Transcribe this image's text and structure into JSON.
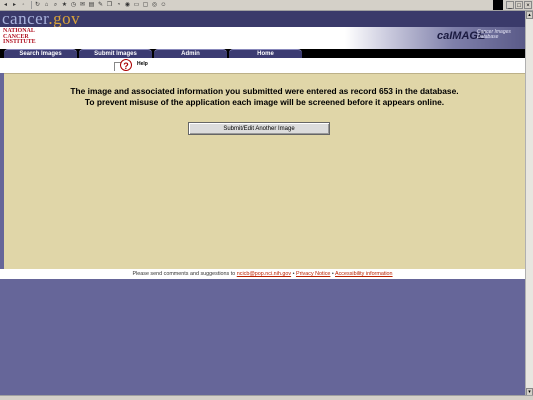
{
  "browser": {
    "toolbar_icons": [
      "back-icon",
      "forward-icon",
      "stop-icon",
      "refresh-icon",
      "home-icon",
      "search-icon",
      "favorites-icon",
      "history-icon",
      "mail-icon",
      "print-icon",
      "edit-icon",
      "discuss-icon",
      "messenger-icon",
      "media-icon",
      "folder-icon",
      "window-icon",
      "camera-icon",
      "user-icon"
    ],
    "window_controls": [
      "_",
      "□",
      "×"
    ]
  },
  "header": {
    "logo_main": "cancer",
    "logo_dot": ".gov",
    "nci_line1": "NATIONAL",
    "nci_line2": "CANCER",
    "nci_line3": "INSTITUTE",
    "app_title": "caIMAGE",
    "app_subtitle_1": "Cancer Images",
    "app_subtitle_2": "Database"
  },
  "nav": {
    "tabs": [
      {
        "label": "Search Images"
      },
      {
        "label": "Submit Images"
      },
      {
        "label": "Admin"
      },
      {
        "label": "Home"
      }
    ]
  },
  "help": {
    "label": "Help"
  },
  "main": {
    "message_line1": "The image and associated information you submitted were entered as record 653 in the database.",
    "message_line2": "To prevent misuse of the application each image will be screened before it appears online.",
    "submit_button": "Submit/Edit Another Image"
  },
  "footer": {
    "text": "Please send comments and suggestions to",
    "email_link": "ncicb@pop.nci.nih.gov",
    "privacy_link": "Privacy Notice",
    "accessibility_link": "Accessibility information",
    "separator": "•"
  },
  "colors": {
    "page_bg": "#666699",
    "content_bg": "#e0d6a8",
    "nav_bg": "#000000",
    "tab_bg": "#3c3c72",
    "link": "#bb2200"
  }
}
